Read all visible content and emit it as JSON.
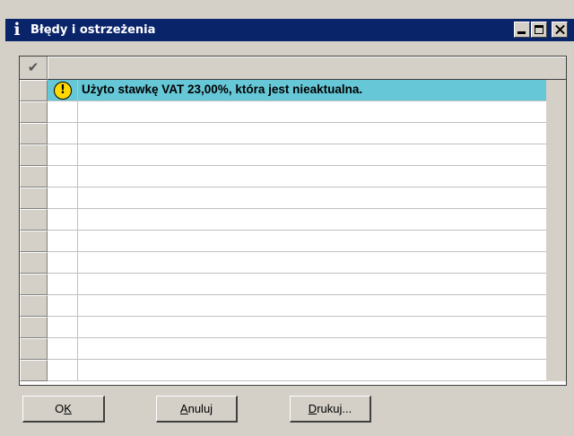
{
  "window": {
    "title": "Błędy i ostrzeżenia",
    "title_icon": "i",
    "colors": {
      "titlebar": "#0a246a",
      "highlight": "#66c7d6",
      "face": "#d4d0c8"
    }
  },
  "grid": {
    "header_check_icon": "check-icon",
    "header_check_glyph": "✔",
    "rows": [
      {
        "icon": "warning-icon",
        "icon_glyph": "!",
        "text": "Użyto stawkę VAT 23,00%, która jest nieaktualna.",
        "selected": true
      }
    ],
    "empty_rows": 13
  },
  "buttons": {
    "ok": {
      "accel": "K",
      "prefix": "O",
      "suffix": ""
    },
    "cancel": {
      "prefix": "",
      "accel": "A",
      "suffix": "nuluj"
    },
    "print": {
      "prefix": "",
      "accel": "D",
      "suffix": "rukuj..."
    }
  }
}
